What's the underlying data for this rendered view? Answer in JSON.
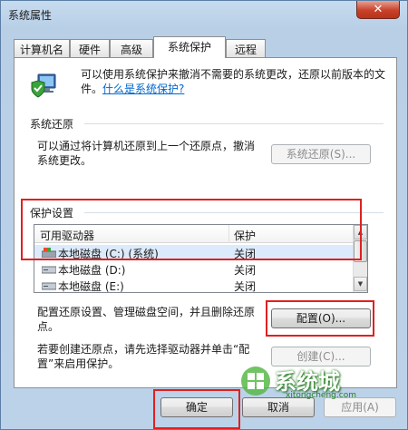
{
  "window": {
    "title": "系统属性",
    "close_label": "✕"
  },
  "tabs": [
    {
      "label": "计算机名"
    },
    {
      "label": "硬件"
    },
    {
      "label": "高级"
    },
    {
      "label": "系统保护"
    },
    {
      "label": "远程"
    }
  ],
  "intro": {
    "text": "可以使用系统保护来撤消不需要的系统更改，还原以前版本的文件。",
    "link": "什么是系统保护?"
  },
  "system_restore": {
    "heading": "系统还原",
    "description": "可以通过将计算机还原到上一个还原点，撤消系统更改。",
    "button": "系统还原(S)..."
  },
  "protection": {
    "heading": "保护设置",
    "columns": [
      "可用驱动器",
      "保护"
    ],
    "rows": [
      {
        "drive": "本地磁盘 (C:) (系统)",
        "status": "关闭",
        "icon": "system-drive-icon"
      },
      {
        "drive": "本地磁盘 (D:)",
        "status": "关闭",
        "icon": "drive-icon"
      },
      {
        "drive": "本地磁盘 (E:)",
        "status": "关闭",
        "icon": "drive-icon"
      }
    ]
  },
  "configure": {
    "description": "配置还原设置、管理磁盘空间，并且删除还原点。",
    "button": "配置(O)..."
  },
  "create": {
    "description": "若要创建还原点，请先选择驱动器并单击“配置”来启用保护。",
    "button": "创建(C)..."
  },
  "footer": {
    "ok": "确定",
    "cancel": "取消",
    "apply": "应用(A)"
  },
  "watermark": {
    "brand": "系统城",
    "url": "xitongcheng.com"
  },
  "colors": {
    "highlight": "#e02020",
    "link": "#0066cc",
    "selected_row": "#dcebfb"
  }
}
